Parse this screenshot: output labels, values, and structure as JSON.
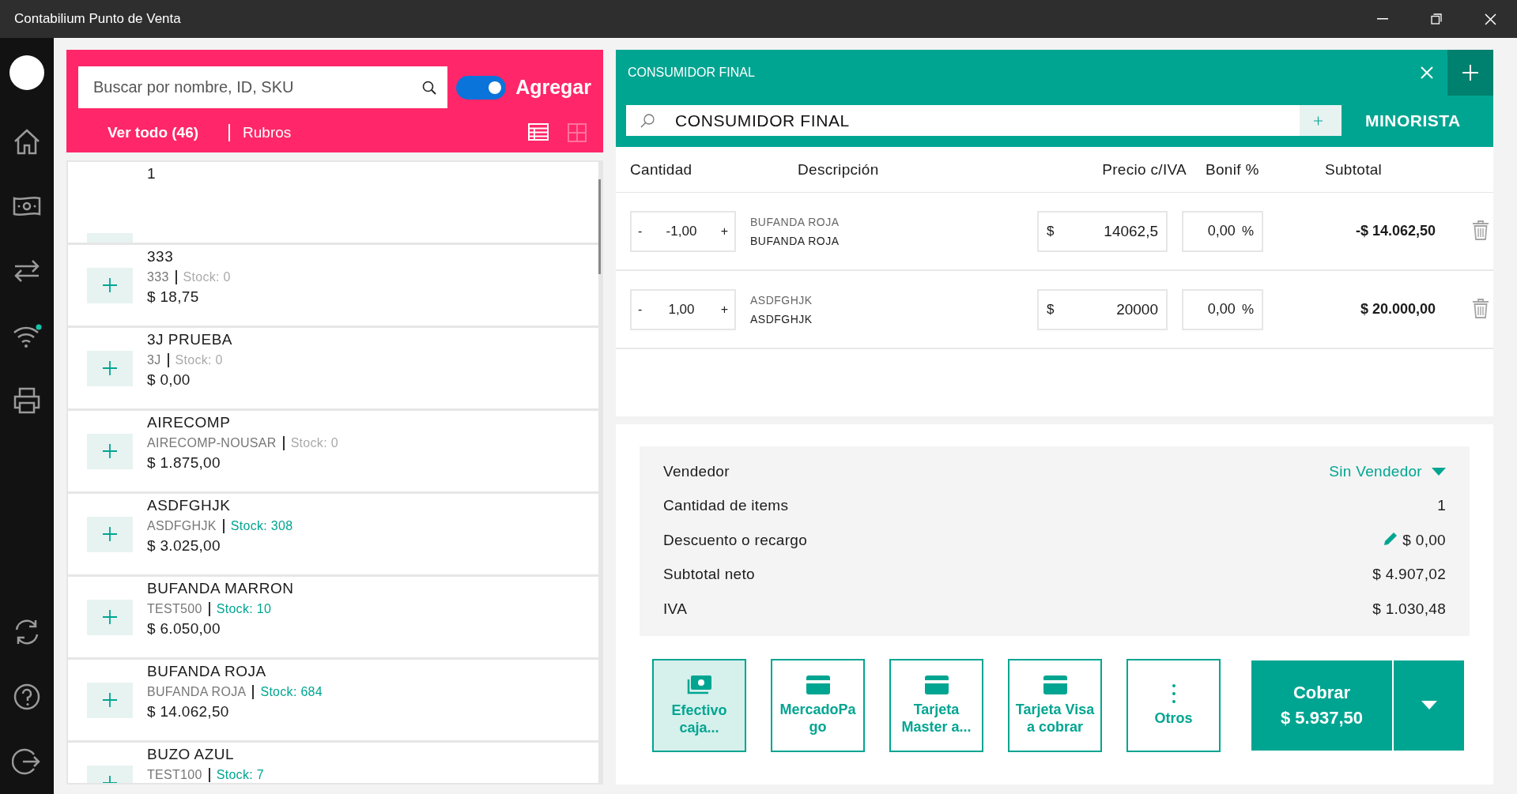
{
  "window": {
    "title": "Contabilium Punto de Venta"
  },
  "products": {
    "search": {
      "placeholder": "Buscar por nombre, ID, SKU"
    },
    "toggle": {
      "label": "Agregar",
      "on": true
    },
    "tabs": [
      {
        "label": "Ver todo (46)",
        "selected": true
      },
      {
        "label": "Rubros",
        "selected": false
      }
    ],
    "views": [
      {
        "kind": "list",
        "selected": true
      },
      {
        "kind": "grid",
        "selected": false
      }
    ],
    "items": [
      {
        "name": "1"
      },
      {
        "name": "333",
        "sku": "333",
        "stock": "Stock: 0",
        "in_stock": false,
        "price": "$ 18,75"
      },
      {
        "name": "3J PRUEBA",
        "sku": "3J",
        "stock": "Stock: 0",
        "in_stock": false,
        "price": "$ 0,00"
      },
      {
        "name": "AIRECOMP",
        "sku": "AIRECOMP-NOUSAR",
        "stock": "Stock: 0",
        "in_stock": false,
        "price": "$ 1.875,00"
      },
      {
        "name": "ASDFGHJK",
        "sku": "ASDFGHJK",
        "stock": "Stock: 308",
        "in_stock": true,
        "price": "$ 3.025,00"
      },
      {
        "name": "BUFANDA MARRON",
        "sku": "TEST500",
        "stock": "Stock: 10",
        "in_stock": true,
        "price": "$ 6.050,00"
      },
      {
        "name": "BUFANDA ROJA",
        "sku": "BUFANDA ROJA",
        "stock": "Stock: 684",
        "in_stock": true,
        "price": "$ 14.062,50"
      },
      {
        "name": "BUZO AZUL",
        "sku": "TEST100",
        "stock": "Stock: 7",
        "in_stock": true
      }
    ]
  },
  "sale": {
    "customer_title": "CONSUMIDOR FINAL",
    "customer": {
      "value": "CONSUMIDOR FINAL"
    },
    "price_list": "MINORISTA",
    "columns": [
      "Cantidad",
      "Descripción",
      "Precio c/IVA",
      "Bonif %",
      "Subtotal"
    ],
    "rows": [
      {
        "minus": "-",
        "quantity": "-1,00",
        "plus": "+",
        "code": "BUFANDA ROJA",
        "description": "BUFANDA ROJA",
        "currency": "$",
        "price": "14062,5",
        "discount": "0,00",
        "percent": "%",
        "subtotal": "-$ 14.062,50"
      },
      {
        "minus": "-",
        "quantity": "1,00",
        "plus": "+",
        "code": "ASDFGHJK",
        "description": "ASDFGHJK",
        "currency": "$",
        "price": "20000",
        "discount": "0,00",
        "percent": "%",
        "subtotal": "$ 20.000,00"
      }
    ],
    "summary": [
      {
        "kind": "select",
        "label": "Vendedor",
        "value": "Sin Vendedor"
      },
      {
        "kind": "text",
        "label": "Cantidad de items",
        "value": "1"
      },
      {
        "kind": "editable",
        "label": "Descuento o recargo",
        "value": "$ 0,00"
      },
      {
        "kind": "text",
        "label": "Subtotal neto",
        "value": "$ 4.907,02"
      },
      {
        "kind": "text",
        "label": "IVA",
        "value": "$ 1.030,48"
      }
    ],
    "payment_methods": [
      {
        "kind": "cash",
        "label": "Efectivo caja...",
        "selected": true
      },
      {
        "kind": "card",
        "label": "MercadoPa go",
        "selected": false
      },
      {
        "kind": "card",
        "label": "Tarjeta Master a...",
        "selected": false
      },
      {
        "kind": "card",
        "label": "Tarjeta Visa a cobrar",
        "selected": false
      },
      {
        "kind": "more",
        "label": "Otros",
        "selected": false
      }
    ],
    "charge": {
      "label": "Cobrar",
      "amount": "$ 5.937,50"
    }
  }
}
